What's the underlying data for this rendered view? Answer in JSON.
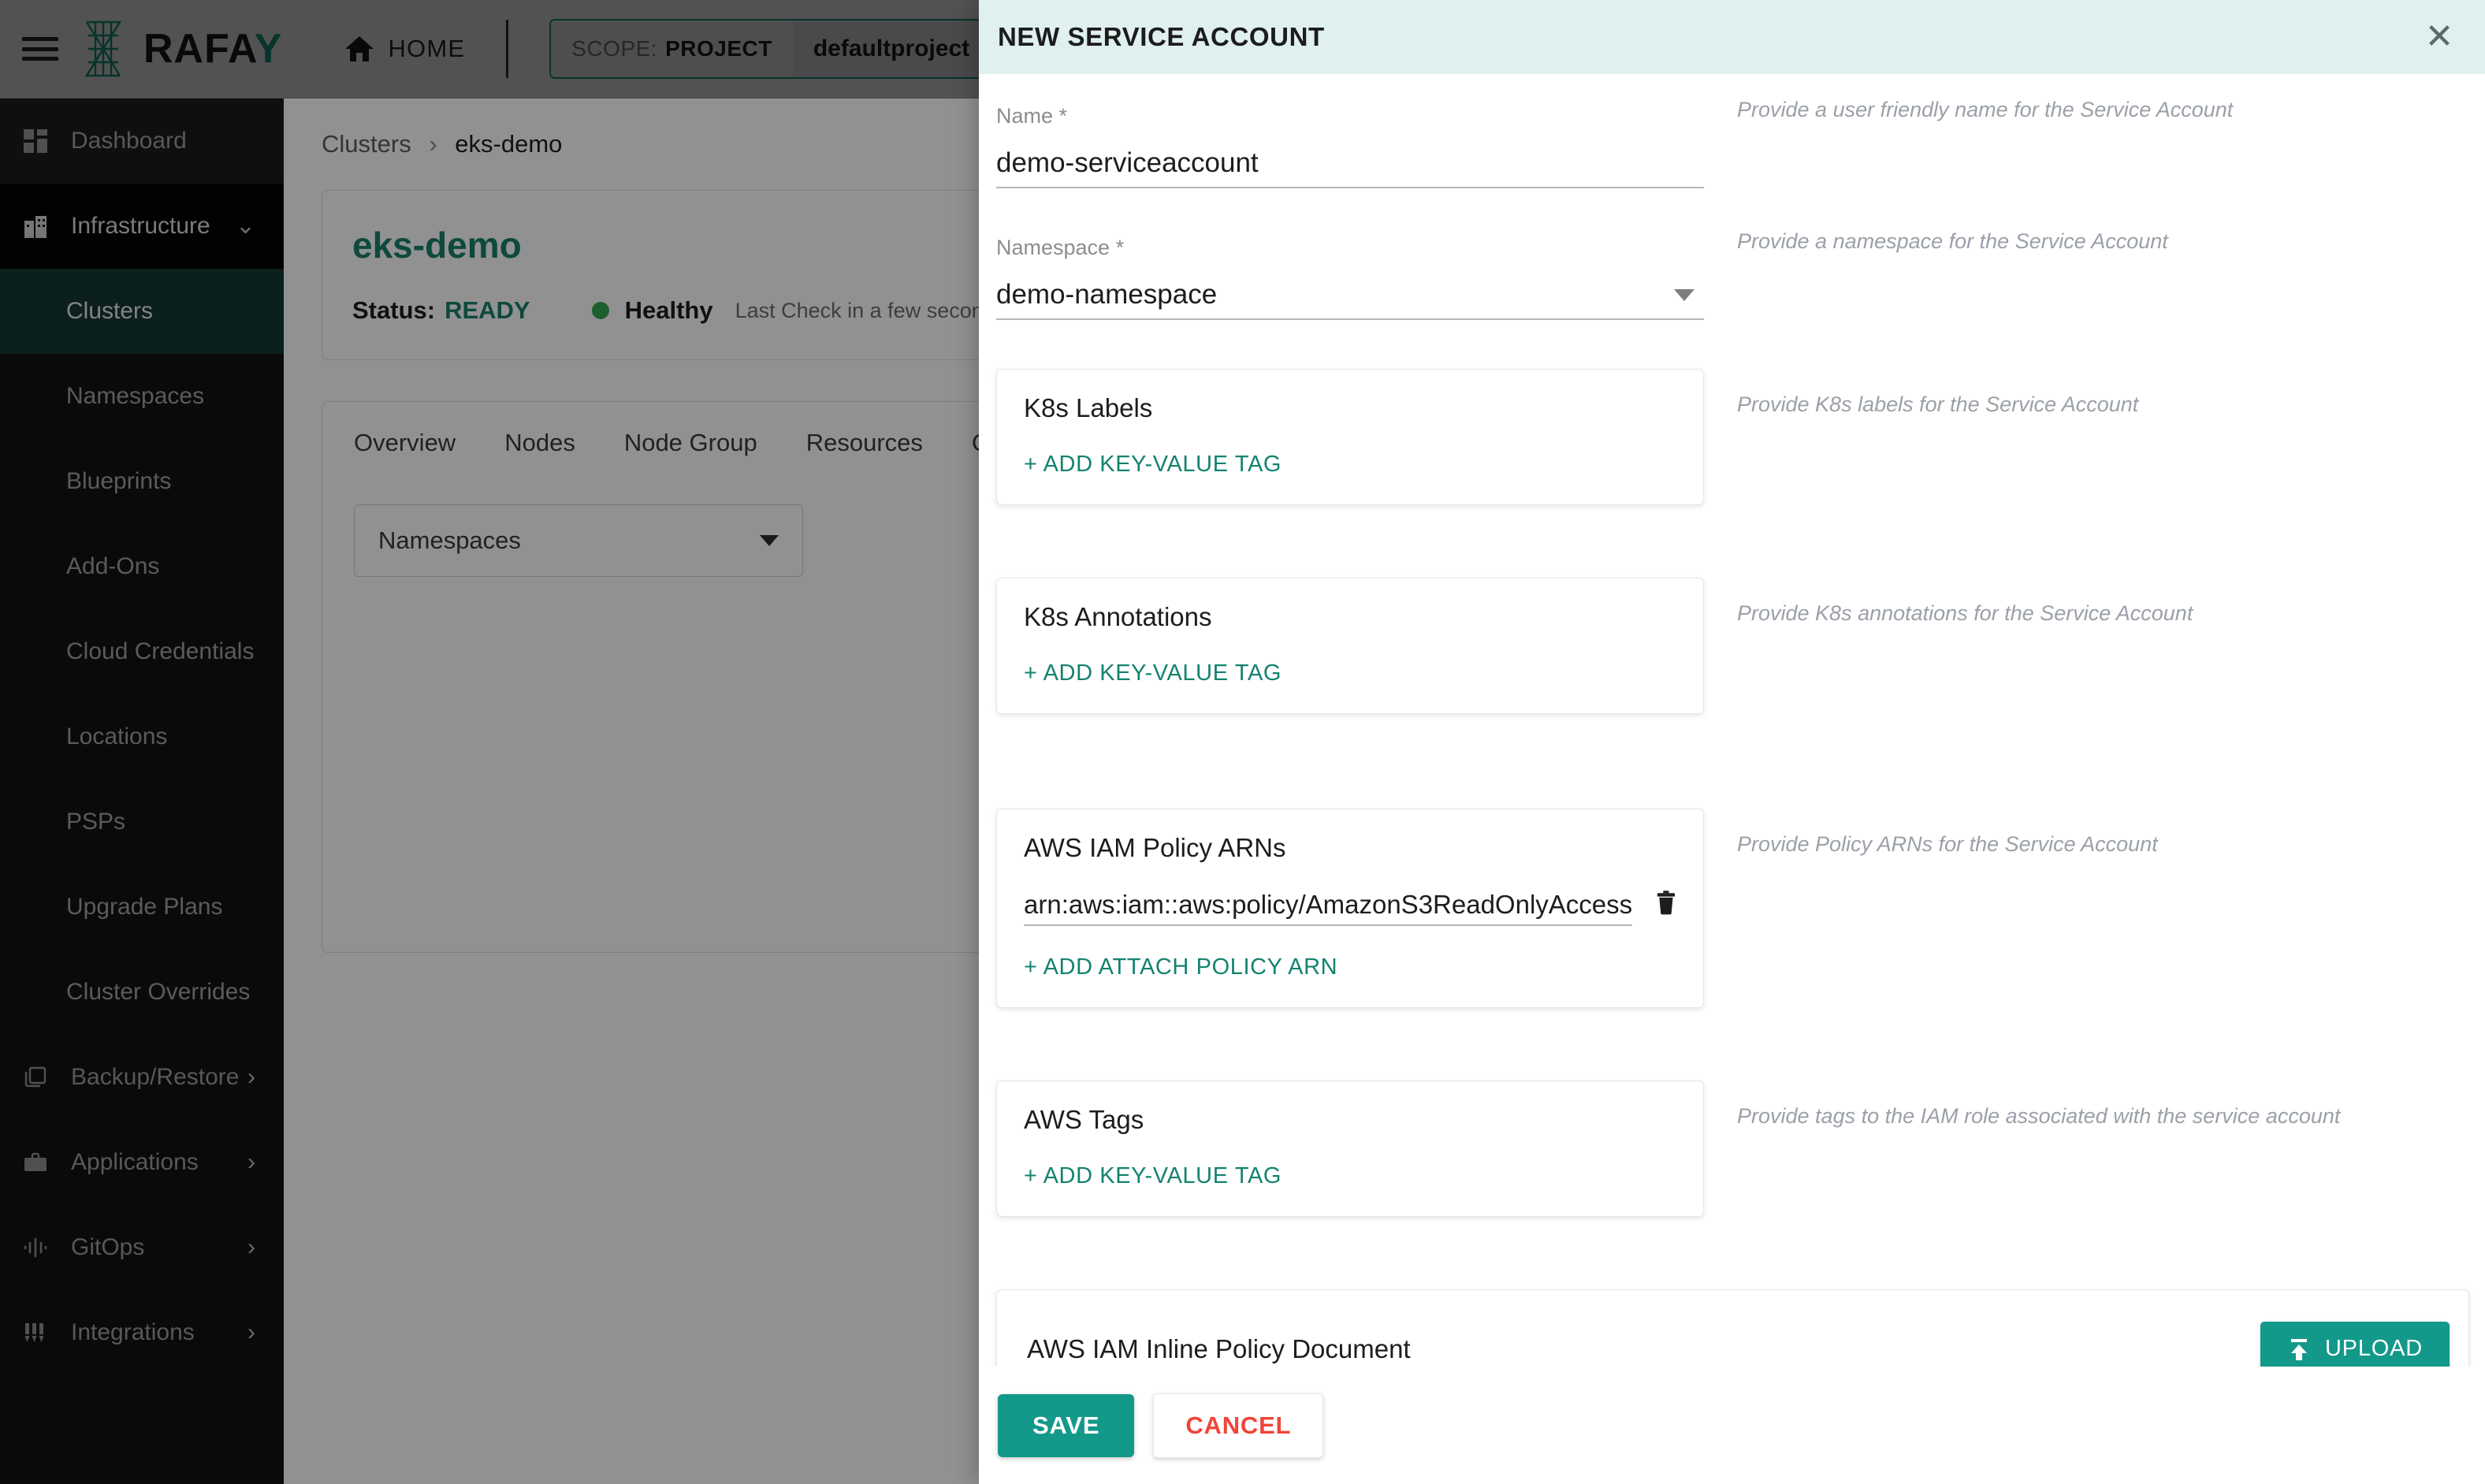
{
  "topbar": {
    "logo_text_main": "RAFA",
    "logo_text_accent": "Y",
    "home_label": "HOME",
    "scope_label": "SCOPE:",
    "scope_type": "PROJECT",
    "scope_project": "defaultproject"
  },
  "sidebar": {
    "items": [
      {
        "label": "Dashboard",
        "icon": "grid-icon",
        "level": "top",
        "chevron": ""
      },
      {
        "label": "Infrastructure",
        "icon": "building-icon",
        "level": "expanded",
        "chevron": "⌄"
      },
      {
        "label": "Clusters",
        "icon": "",
        "level": "sub-active",
        "chevron": ""
      },
      {
        "label": "Namespaces",
        "icon": "",
        "level": "sub",
        "chevron": ""
      },
      {
        "label": "Blueprints",
        "icon": "",
        "level": "sub",
        "chevron": ""
      },
      {
        "label": "Add-Ons",
        "icon": "",
        "level": "sub",
        "chevron": ""
      },
      {
        "label": "Cloud Credentials",
        "icon": "",
        "level": "sub",
        "chevron": ""
      },
      {
        "label": "Locations",
        "icon": "",
        "level": "sub",
        "chevron": ""
      },
      {
        "label": "PSPs",
        "icon": "",
        "level": "sub",
        "chevron": ""
      },
      {
        "label": "Upgrade Plans",
        "icon": "",
        "level": "sub",
        "chevron": ""
      },
      {
        "label": "Cluster Overrides",
        "icon": "",
        "level": "sub",
        "chevron": ""
      },
      {
        "label": "Backup/Restore",
        "icon": "layers-icon",
        "level": "top",
        "chevron": "›"
      },
      {
        "label": "Applications",
        "icon": "briefcase-icon",
        "level": "top",
        "chevron": "›"
      },
      {
        "label": "GitOps",
        "icon": "pipeline-icon",
        "level": "top",
        "chevron": "›"
      },
      {
        "label": "Integrations",
        "icon": "sliders-icon",
        "level": "top",
        "chevron": "›"
      }
    ]
  },
  "main": {
    "breadcrumb_root": "Clusters",
    "breadcrumb_sep": "›",
    "breadcrumb_current": "eks-demo",
    "cluster_name": "eks-demo",
    "status_key": "Status:",
    "status_value": "READY",
    "health_label": "Healthy",
    "last_check": "Last Check in a few seconds ago",
    "tabs": [
      "Overview",
      "Nodes",
      "Node Group",
      "Resources",
      "Con"
    ],
    "namespaces_select": "Namespaces"
  },
  "modal": {
    "title": "NEW SERVICE ACCOUNT",
    "close_icon": "✕",
    "name": {
      "label": "Name *",
      "value": "demo-serviceaccount",
      "help": "Provide a user friendly name for the Service Account"
    },
    "namespace": {
      "label": "Namespace *",
      "value": "demo-namespace",
      "help": "Provide a namespace for the Service Account"
    },
    "k8s_labels": {
      "title": "K8s Labels",
      "action": "+ ADD KEY-VALUE TAG",
      "help": "Provide K8s labels for the Service Account"
    },
    "k8s_annotations": {
      "title": "K8s Annotations",
      "action": "+ ADD KEY-VALUE TAG",
      "help": "Provide K8s annotations for the Service Account"
    },
    "policy_arns": {
      "title": "AWS IAM Policy ARNs",
      "value": "arn:aws:iam::aws:policy/AmazonS3ReadOnlyAccess",
      "action": "+ ADD  ATTACH POLICY ARN",
      "help": "Provide Policy ARNs for the Service Account"
    },
    "aws_tags": {
      "title": "AWS Tags",
      "action": "+ ADD KEY-VALUE TAG",
      "help": "Provide tags to the IAM role associated with the service account"
    },
    "inline_policy": {
      "title": "AWS IAM Inline Policy Document",
      "upload_label": "UPLOAD"
    },
    "footer": {
      "save_label": "SAVE",
      "cancel_label": "CANCEL"
    }
  },
  "colors": {
    "brand_teal": "#13998a",
    "modal_header": "#dff0ef",
    "sidebar_bg": "#131313",
    "sidebar_active": "#143832",
    "cancel_red": "#f0453a",
    "status_green": "#19806c",
    "health_dot": "#35a853"
  }
}
